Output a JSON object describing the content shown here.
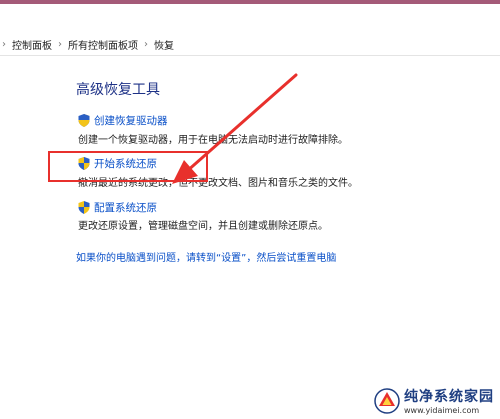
{
  "window": {
    "accent_color": "#a45a78"
  },
  "breadcrumb": {
    "items": [
      "控制面板",
      "所有控制面板项",
      "恢复"
    ],
    "separator": "›"
  },
  "main": {
    "heading": "高级恢复工具",
    "items": [
      {
        "title": "创建恢复驱动器",
        "description": "创建一个恢复驱动器，用于在电脑无法启动时进行故障排除。",
        "icon": "shield-icon"
      },
      {
        "title": "开始系统还原",
        "description": "撤消最近的系统更改，但不更改文档、图片和音乐之类的文件。",
        "icon": "shield-icon"
      },
      {
        "title": "配置系统还原",
        "description": "更改还原设置，管理磁盘空间，并且创建或删除还原点。",
        "icon": "shield-icon"
      }
    ],
    "help_link": "如果你的电脑遇到问题，请转到“设置”，然后尝试重置电脑"
  },
  "annotation": {
    "highlight_color": "#e8302c"
  },
  "watermark": {
    "title": "纯净系统家园",
    "url": "www.yidaimei.com"
  }
}
